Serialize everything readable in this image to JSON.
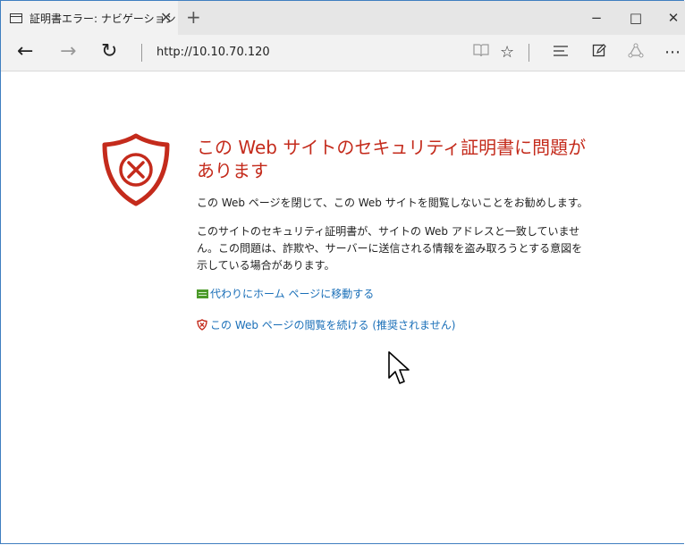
{
  "browser": {
    "tab": {
      "title": "証明書エラー: ナビゲーション",
      "close_glyph": "✕"
    },
    "new_tab_glyph": "+",
    "window": {
      "minimize": "−",
      "maximize": "□",
      "close": "✕"
    },
    "nav": {
      "back": "←",
      "forward": "→",
      "refresh": "↻",
      "url": "http://10.10.70.120"
    },
    "tools": {
      "reading_view": "📖",
      "favorite": "☆",
      "hub": "☰",
      "web_note": "✎",
      "share": "◌",
      "more": "⋯"
    }
  },
  "error_page": {
    "heading": "この Web サイトのセキュリティ証明書に問題があります",
    "recommendation": "この Web ページを閉じて、この Web サイトを閲覧しないことをお勧めします。",
    "details": "このサイトのセキュリティ証明書が、サイトの Web アドレスと一致していません。この問題は、詐欺や、サーバーに送信される情報を盗み取ろうとする意図を示している場合があります。",
    "link_home": "代わりにホーム ページに移動する",
    "link_continue": "この Web ページの閲覧を続ける (推奨されません)"
  },
  "colors": {
    "accent_red": "#c42b1c",
    "link_blue": "#1a6fb8",
    "home_icon_green": "#4c9a2a"
  }
}
